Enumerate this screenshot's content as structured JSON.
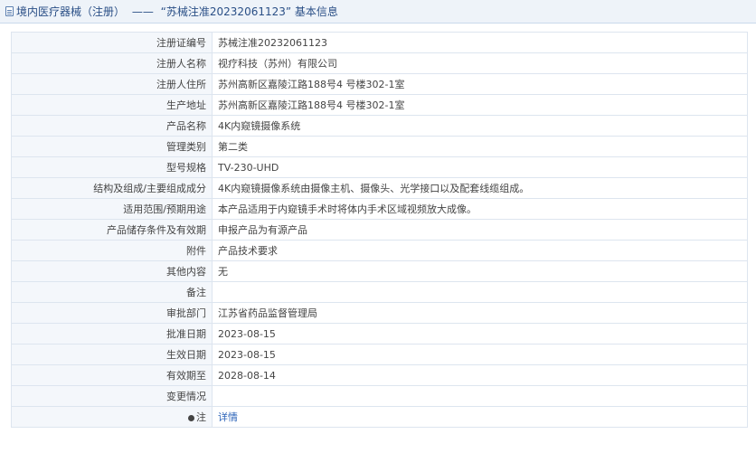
{
  "header": {
    "category": "境内医疗器械（注册）",
    "separator": "——",
    "quoted_title": "“苏械注准20232061123”",
    "suffix": "基本信息"
  },
  "rows": [
    {
      "label": "注册证编号",
      "value": "苏械注准20232061123"
    },
    {
      "label": "注册人名称",
      "value": "视疗科技（苏州）有限公司"
    },
    {
      "label": "注册人住所",
      "value": "苏州高新区嘉陵江路188号4 号楼302-1室"
    },
    {
      "label": "生产地址",
      "value": "苏州高新区嘉陵江路188号4 号楼302-1室"
    },
    {
      "label": "产品名称",
      "value": "4K内窥镜摄像系统"
    },
    {
      "label": "管理类别",
      "value": "第二类"
    },
    {
      "label": "型号规格",
      "value": "TV-230-UHD"
    },
    {
      "label": "结构及组成/主要组成成分",
      "value": "4K内窥镜摄像系统由摄像主机、摄像头、光学接口以及配套线缆组成。"
    },
    {
      "label": "适用范围/预期用途",
      "value": "本产品适用于内窥镜手术时将体内手术区域视频放大成像。"
    },
    {
      "label": "产品储存条件及有效期",
      "value": "申报产品为有源产品"
    },
    {
      "label": "附件",
      "value": "产品技术要求"
    },
    {
      "label": "其他内容",
      "value": "无"
    },
    {
      "label": "备注",
      "value": ""
    },
    {
      "label": "审批部门",
      "value": "江苏省药品监督管理局"
    },
    {
      "label": "批准日期",
      "value": "2023-08-15"
    },
    {
      "label": "生效日期",
      "value": "2023-08-15"
    },
    {
      "label": "有效期至",
      "value": "2028-08-14"
    },
    {
      "label": "变更情况",
      "value": ""
    },
    {
      "label": "注",
      "value": "详情"
    }
  ]
}
